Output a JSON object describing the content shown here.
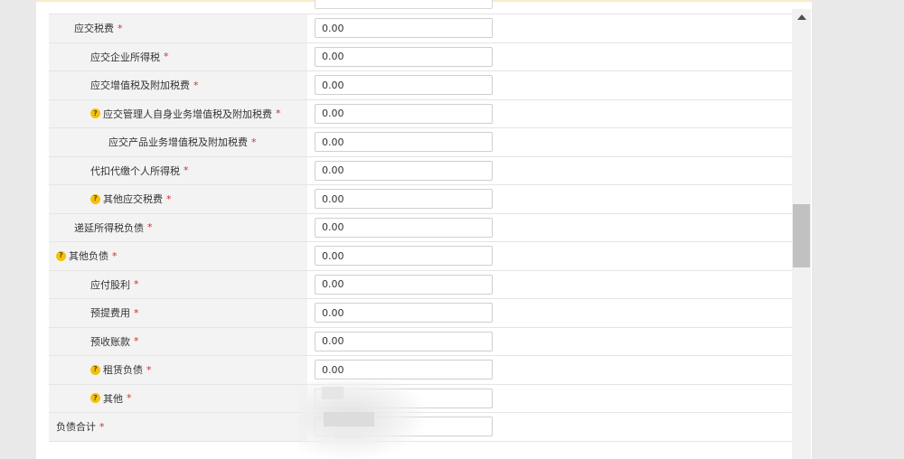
{
  "form": {
    "rows": [
      {
        "label": "应交税费",
        "level": 0,
        "help": false,
        "value": "0.00"
      },
      {
        "label": "应交企业所得税",
        "level": 1,
        "help": false,
        "value": "0.00"
      },
      {
        "label": "应交增值税及附加税费",
        "level": 1,
        "help": false,
        "value": "0.00"
      },
      {
        "label": "应交管理人自身业务增值税及附加税费",
        "level": 2,
        "help": true,
        "value": "0.00"
      },
      {
        "label": "应交产品业务增值税及附加税费",
        "level": 3,
        "help": false,
        "value": "0.00"
      },
      {
        "label": "代扣代缴个人所得税",
        "level": 1,
        "help": false,
        "value": "0.00"
      },
      {
        "label": "其他应交税费",
        "level": 1,
        "help": true,
        "value": "0.00"
      },
      {
        "label": "递延所得税负债",
        "level": 0,
        "help": false,
        "value": "0.00"
      },
      {
        "label": "其他负债",
        "level": 0,
        "help": true,
        "value": "0.00"
      },
      {
        "label": "应付股利",
        "level": 1,
        "help": false,
        "value": "0.00"
      },
      {
        "label": "预提费用",
        "level": 1,
        "help": false,
        "value": "0.00"
      },
      {
        "label": "预收账款",
        "level": 1,
        "help": false,
        "value": "0.00"
      },
      {
        "label": "租赁负债",
        "level": 1,
        "help": true,
        "value": "0.00"
      },
      {
        "label": "其他",
        "level": 1,
        "help": true,
        "value": ""
      },
      {
        "label": "负债合计",
        "level": -1,
        "help": false,
        "value": ""
      }
    ],
    "required_mark": "*",
    "help_mark": "?"
  }
}
